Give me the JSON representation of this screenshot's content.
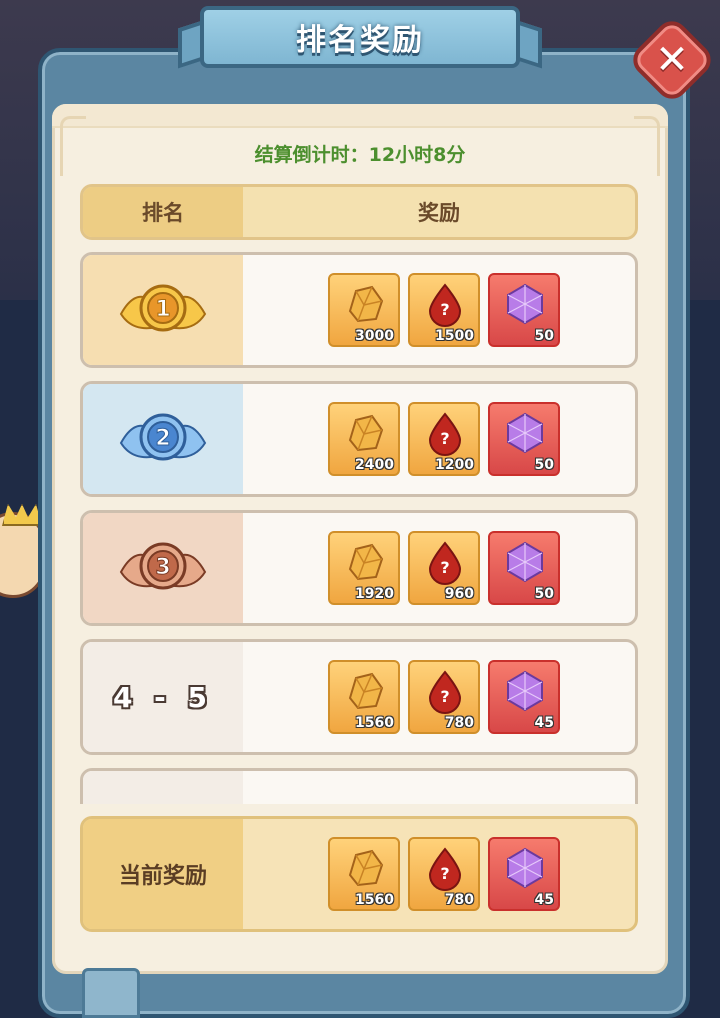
{
  "title": "排名奖励",
  "close_icon": "close-icon",
  "countdown": "结算倒计时：12小时8分",
  "table_header": {
    "rank": "排名",
    "reward": "奖励"
  },
  "rows": [
    {
      "rank": "1",
      "bg": "#f6deb1",
      "medal": "gold-medal-icon",
      "rewards": [
        "3000",
        "1500",
        "50"
      ]
    },
    {
      "rank": "2",
      "bg": "#d4e7f1",
      "medal": "silver-medal-icon",
      "rewards": [
        "2400",
        "1200",
        "50"
      ]
    },
    {
      "rank": "3",
      "bg": "#f1d7c4",
      "medal": "bronze-medal-icon",
      "rewards": [
        "1920",
        "960",
        "50"
      ]
    },
    {
      "rank": "4 - 5",
      "bg": "#f3ede6",
      "medal": "",
      "rewards": [
        "1560",
        "780",
        "45"
      ]
    }
  ],
  "current": {
    "label": "当前奖励",
    "rewards": [
      "1560",
      "780",
      "45"
    ]
  },
  "reward_items": [
    "gold-ore-icon",
    "red-potion-icon",
    "purple-gem-icon"
  ]
}
